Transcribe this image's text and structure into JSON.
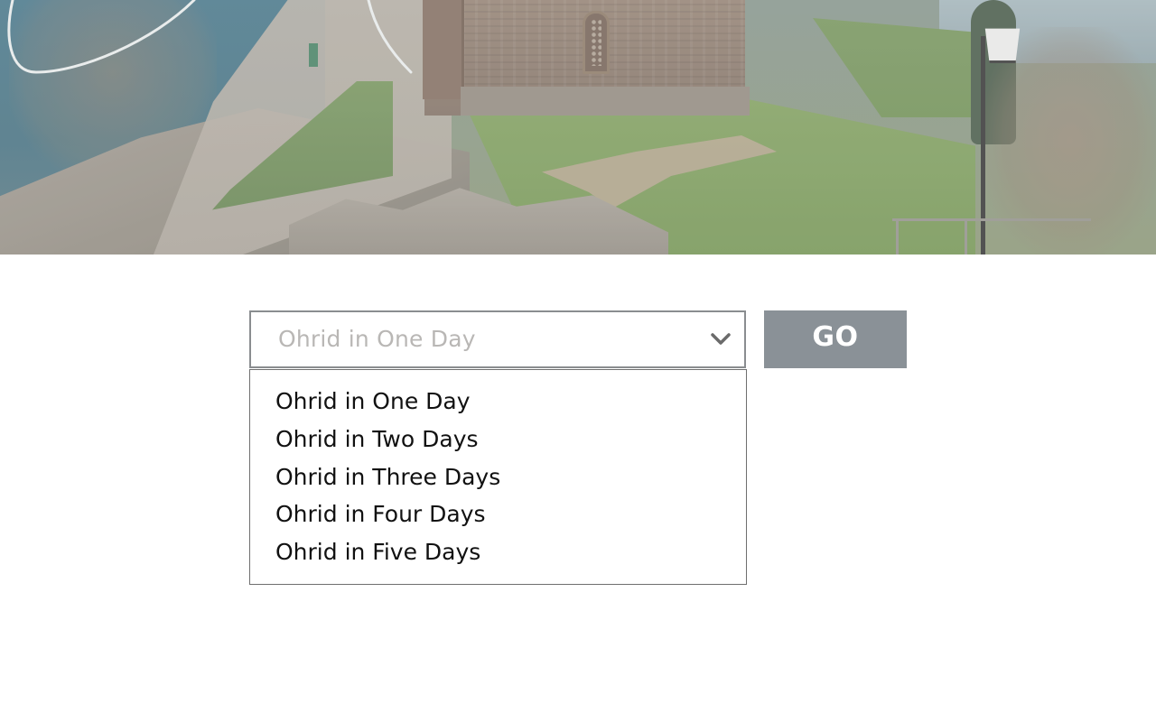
{
  "hero": {
    "image_icon": "ohrid-church-photo"
  },
  "itinerary_select": {
    "selected_label": "Ohrid in One Day",
    "chevron_icon": "chevron-down-icon",
    "options": [
      "Ohrid in One Day",
      "Ohrid in Two Days",
      "Ohrid in Three Days",
      "Ohrid in Four Days",
      "Ohrid in Five Days"
    ]
  },
  "go_button": {
    "label": "GO"
  },
  "colors": {
    "go_button_bg": "#8a9197",
    "select_border": "#8a8d90",
    "placeholder_text": "#b9b7b5",
    "option_text": "#111111"
  }
}
